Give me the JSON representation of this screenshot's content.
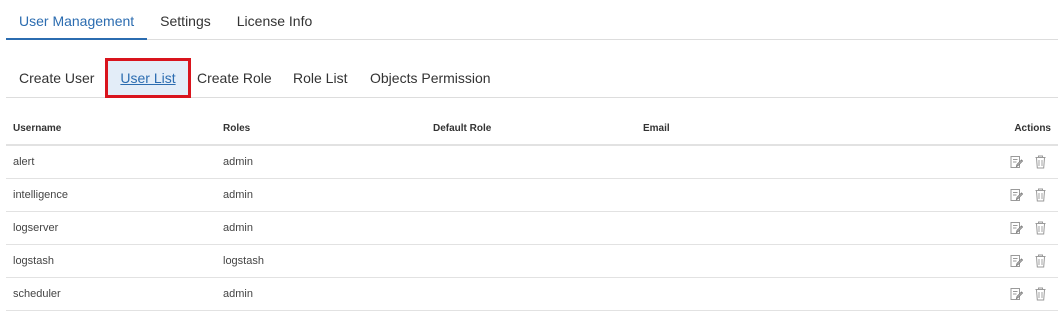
{
  "top_tabs": [
    {
      "label": "User Management",
      "active": true
    },
    {
      "label": "Settings",
      "active": false
    },
    {
      "label": "License Info",
      "active": false
    }
  ],
  "sub_tabs": [
    {
      "label": "Create User",
      "active": false
    },
    {
      "label": "User List",
      "active": true
    },
    {
      "label": "Create Role",
      "active": false
    },
    {
      "label": "Role List",
      "active": false
    },
    {
      "label": "Objects Permission",
      "active": false
    }
  ],
  "table": {
    "headers": [
      "Username",
      "Roles",
      "Default Role",
      "Email",
      "Actions"
    ],
    "rows": [
      {
        "username": "alert",
        "roles": "admin",
        "default_role": "",
        "email": ""
      },
      {
        "username": "intelligence",
        "roles": "admin",
        "default_role": "",
        "email": ""
      },
      {
        "username": "logserver",
        "roles": "admin",
        "default_role": "",
        "email": ""
      },
      {
        "username": "logstash",
        "roles": "logstash",
        "default_role": "",
        "email": ""
      },
      {
        "username": "scheduler",
        "roles": "admin",
        "default_role": "",
        "email": ""
      }
    ],
    "row_actions": [
      "edit-icon",
      "delete-icon"
    ]
  },
  "colors": {
    "accent": "#2b6cb0",
    "highlight_border": "#d9141d",
    "active_subtab_bg": "#e3edf8"
  }
}
